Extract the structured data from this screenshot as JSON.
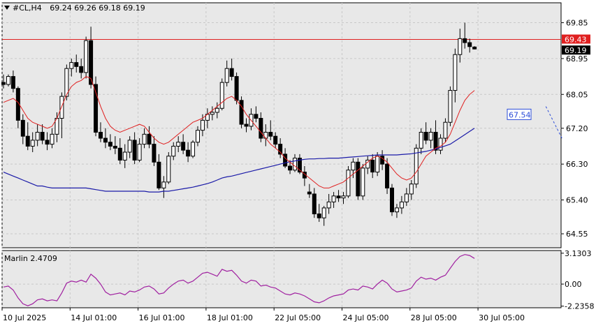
{
  "header": {
    "symbol": "#CL,H4",
    "ohlc": "69.24 69.26 69.18 69.19"
  },
  "price_tags": {
    "resistance": "69.43",
    "current": "69.19",
    "target": "67.54"
  },
  "indicator": {
    "label": "Marlin 2.4709"
  },
  "colors": {
    "background": "#ffffff",
    "plot_bg": "#e8e8e8",
    "grid": "#c8c8c8",
    "candle": "#000000",
    "red_line": "#e02020",
    "blue_ma": "#1a1aa8",
    "target_line": "#2a4bd7",
    "marlin": "#a020a0"
  },
  "chart_data": [
    {
      "type": "candlestick",
      "title": "#CL,H4",
      "ylim": [
        64.2,
        70.35
      ],
      "y_ticks": [
        "69.85",
        "68.95",
        "68.05",
        "67.20",
        "66.30",
        "65.40",
        "64.55"
      ],
      "x_ticks": [
        "10 Jul 2025",
        "14 Jul 01:00",
        "16 Jul 01:00",
        "18 Jul 01:00",
        "22 Jul 05:00",
        "24 Jul 05:00",
        "28 Jul 05:00",
        "30 Jul 05:00"
      ],
      "horizontal_line": 69.43,
      "target_line": {
        "from_index": 115,
        "from": 66.95,
        "to": 67.54
      },
      "candles": [
        [
          68.35,
          68.55,
          68.2,
          68.3
        ],
        [
          68.3,
          68.55,
          68.25,
          68.5
        ],
        [
          68.5,
          68.65,
          68.1,
          68.2
        ],
        [
          68.2,
          68.25,
          67.2,
          67.4
        ],
        [
          67.4,
          67.55,
          66.8,
          67.0
        ],
        [
          67.0,
          67.35,
          66.65,
          66.75
        ],
        [
          66.75,
          67.1,
          66.6,
          66.9
        ],
        [
          66.9,
          67.3,
          66.75,
          67.1
        ],
        [
          67.1,
          67.3,
          66.8,
          66.9
        ],
        [
          66.9,
          67.1,
          66.65,
          66.8
        ],
        [
          66.8,
          67.2,
          66.7,
          67.05
        ],
        [
          67.05,
          67.6,
          66.85,
          67.45
        ],
        [
          67.45,
          68.1,
          66.95,
          68.0
        ],
        [
          68.0,
          68.8,
          67.9,
          68.7
        ],
        [
          68.7,
          68.95,
          68.5,
          68.85
        ],
        [
          68.85,
          69.05,
          68.6,
          68.75
        ],
        [
          68.75,
          68.95,
          68.45,
          68.6
        ],
        [
          68.6,
          69.5,
          68.45,
          69.4
        ],
        [
          69.4,
          69.75,
          68.2,
          68.3
        ],
        [
          68.3,
          68.5,
          67.0,
          67.1
        ],
        [
          67.1,
          67.35,
          66.85,
          66.95
        ],
        [
          66.95,
          67.2,
          66.7,
          66.85
        ],
        [
          66.85,
          67.05,
          66.65,
          66.75
        ],
        [
          66.75,
          67.0,
          66.55,
          66.7
        ],
        [
          66.7,
          66.95,
          66.3,
          66.4
        ],
        [
          66.4,
          66.8,
          66.2,
          66.6
        ],
        [
          66.6,
          67.0,
          66.45,
          66.9
        ],
        [
          66.9,
          67.1,
          66.3,
          66.4
        ],
        [
          66.4,
          66.95,
          66.35,
          66.8
        ],
        [
          66.8,
          67.2,
          66.7,
          67.05
        ],
        [
          67.05,
          67.25,
          66.7,
          66.8
        ],
        [
          66.8,
          67.0,
          66.25,
          66.35
        ],
        [
          66.35,
          66.55,
          65.65,
          65.7
        ],
        [
          65.7,
          66.0,
          65.45,
          65.85
        ],
        [
          65.85,
          66.6,
          65.8,
          66.5
        ],
        [
          66.5,
          66.85,
          66.4,
          66.75
        ],
        [
          66.75,
          67.0,
          66.6,
          66.85
        ],
        [
          66.85,
          67.05,
          66.55,
          66.65
        ],
        [
          66.65,
          66.85,
          66.35,
          66.5
        ],
        [
          66.5,
          66.9,
          66.45,
          66.85
        ],
        [
          66.85,
          67.25,
          66.75,
          67.15
        ],
        [
          67.15,
          67.55,
          67.0,
          67.4
        ],
        [
          67.4,
          67.7,
          67.2,
          67.55
        ],
        [
          67.55,
          67.75,
          67.4,
          67.6
        ],
        [
          67.6,
          67.85,
          67.45,
          67.7
        ],
        [
          67.7,
          68.45,
          67.65,
          68.35
        ],
        [
          68.35,
          68.9,
          68.25,
          68.7
        ],
        [
          68.7,
          68.95,
          68.4,
          68.5
        ],
        [
          68.5,
          68.6,
          67.8,
          67.9
        ],
        [
          67.9,
          68.0,
          67.2,
          67.3
        ],
        [
          67.3,
          67.45,
          67.1,
          67.25
        ],
        [
          67.25,
          67.7,
          67.15,
          67.55
        ],
        [
          67.55,
          67.75,
          67.35,
          67.45
        ],
        [
          67.45,
          67.6,
          66.85,
          66.95
        ],
        [
          66.95,
          67.3,
          66.75,
          67.1
        ],
        [
          67.1,
          67.4,
          66.9,
          67.0
        ],
        [
          67.0,
          67.1,
          66.7,
          66.8
        ],
        [
          66.8,
          66.95,
          66.45,
          66.55
        ],
        [
          66.55,
          66.7,
          66.2,
          66.25
        ],
        [
          66.25,
          66.4,
          66.05,
          66.15
        ],
        [
          66.15,
          66.55,
          66.1,
          66.45
        ],
        [
          66.45,
          66.55,
          66.05,
          66.1
        ],
        [
          66.1,
          66.25,
          65.75,
          65.95
        ],
        [
          65.6,
          65.8,
          65.45,
          65.55
        ],
        [
          65.55,
          65.7,
          64.95,
          65.05
        ],
        [
          65.05,
          65.3,
          64.85,
          64.95
        ],
        [
          64.95,
          65.25,
          64.75,
          65.2
        ],
        [
          65.2,
          65.55,
          65.05,
          65.35
        ],
        [
          65.35,
          65.6,
          65.2,
          65.5
        ],
        [
          65.5,
          65.65,
          65.35,
          65.45
        ],
        [
          65.45,
          65.6,
          65.3,
          65.5
        ],
        [
          65.5,
          66.25,
          65.45,
          66.15
        ],
        [
          66.15,
          66.45,
          65.95,
          66.35
        ],
        [
          66.35,
          66.45,
          65.4,
          65.5
        ],
        [
          65.5,
          66.3,
          65.4,
          66.2
        ],
        [
          66.2,
          66.5,
          66.05,
          66.4
        ],
        [
          66.4,
          66.55,
          65.95,
          66.1
        ],
        [
          66.1,
          66.6,
          66.0,
          66.5
        ],
        [
          66.5,
          66.65,
          66.15,
          66.3
        ],
        [
          66.3,
          66.45,
          65.55,
          65.7
        ],
        [
          65.7,
          65.8,
          65.0,
          65.1
        ],
        [
          65.1,
          65.3,
          64.95,
          65.2
        ],
        [
          65.2,
          65.5,
          65.05,
          65.35
        ],
        [
          65.35,
          65.7,
          65.25,
          65.55
        ],
        [
          65.55,
          65.9,
          65.4,
          65.8
        ],
        [
          65.8,
          66.8,
          65.7,
          66.7
        ],
        [
          66.7,
          67.2,
          66.55,
          67.1
        ],
        [
          67.1,
          67.35,
          66.8,
          66.9
        ],
        [
          66.9,
          67.2,
          66.7,
          67.1
        ],
        [
          67.1,
          67.4,
          66.55,
          66.65
        ],
        [
          66.65,
          67.05,
          66.55,
          66.95
        ],
        [
          66.95,
          67.45,
          66.85,
          67.35
        ],
        [
          67.35,
          68.25,
          67.25,
          68.15
        ],
        [
          68.15,
          69.2,
          67.85,
          69.05
        ],
        [
          69.05,
          69.7,
          68.85,
          69.45
        ],
        [
          69.45,
          69.85,
          69.2,
          69.35
        ],
        [
          69.35,
          69.45,
          69.1,
          69.25
        ],
        [
          69.24,
          69.26,
          69.18,
          69.19
        ]
      ],
      "red_line": [
        67.85,
        67.9,
        67.95,
        67.85,
        67.65,
        67.45,
        67.35,
        67.3,
        67.25,
        67.2,
        67.25,
        67.45,
        67.75,
        68.05,
        68.25,
        68.35,
        68.4,
        68.5,
        68.45,
        68.1,
        67.75,
        67.45,
        67.25,
        67.15,
        67.1,
        67.15,
        67.2,
        67.25,
        67.3,
        67.25,
        67.1,
        66.95,
        66.85,
        66.8,
        66.85,
        66.95,
        67.05,
        67.15,
        67.25,
        67.35,
        67.4,
        67.45,
        67.55,
        67.65,
        67.75,
        67.85,
        67.95,
        68.0,
        67.9,
        67.75,
        67.55,
        67.4,
        67.25,
        67.1,
        66.95,
        66.8,
        66.7,
        66.6,
        66.45,
        66.35,
        66.25,
        66.15,
        66.05,
        65.95,
        65.85,
        65.75,
        65.7,
        65.7,
        65.75,
        65.8,
        65.85,
        65.95,
        66.05,
        66.15,
        66.25,
        66.35,
        66.45,
        66.5,
        66.45,
        66.35,
        66.2,
        66.05,
        65.95,
        65.9,
        65.95,
        66.1,
        66.3,
        66.5,
        66.6,
        66.7,
        66.75,
        66.85,
        67.05,
        67.35,
        67.65,
        67.9,
        68.05,
        68.15
      ],
      "blue_ma": [
        66.1,
        66.05,
        66.0,
        65.95,
        65.9,
        65.85,
        65.8,
        65.75,
        65.75,
        65.72,
        65.7,
        65.7,
        65.7,
        65.7,
        65.7,
        65.7,
        65.7,
        65.7,
        65.68,
        65.66,
        65.64,
        65.62,
        65.62,
        65.62,
        65.62,
        65.62,
        65.62,
        65.62,
        65.62,
        65.62,
        65.6,
        65.6,
        65.6,
        65.62,
        65.62,
        65.64,
        65.66,
        65.68,
        65.7,
        65.72,
        65.75,
        65.78,
        65.81,
        65.85,
        65.9,
        65.95,
        65.98,
        66.0,
        66.03,
        66.06,
        66.09,
        66.12,
        66.15,
        66.18,
        66.21,
        66.24,
        66.27,
        66.3,
        66.33,
        66.36,
        66.38,
        66.4,
        66.42,
        66.43,
        66.43,
        66.44,
        66.44,
        66.45,
        66.45,
        66.45,
        66.46,
        66.47,
        66.48,
        66.49,
        66.5,
        66.51,
        66.52,
        66.53,
        66.53,
        66.53,
        66.53,
        66.53,
        66.54,
        66.55,
        66.56,
        66.58,
        66.6,
        66.62,
        66.65,
        66.68,
        66.72,
        66.76,
        66.8,
        66.88,
        66.96,
        67.04,
        67.12,
        67.2
      ]
    },
    {
      "type": "line",
      "title": "Marlin 2.4709",
      "ylim": [
        -2.4,
        3.4
      ],
      "y_ticks": [
        "3.1303",
        "0.00",
        "-2.2358"
      ],
      "values": [
        -0.3,
        -0.2,
        -0.6,
        -1.4,
        -2.0,
        -2.2,
        -2.0,
        -1.6,
        -1.5,
        -1.7,
        -1.6,
        -1.7,
        -0.9,
        0.1,
        0.3,
        0.2,
        0.4,
        0.2,
        1.0,
        0.6,
        0.0,
        -0.8,
        -1.1,
        -1.0,
        -0.9,
        -1.1,
        -0.7,
        -0.8,
        -0.6,
        -0.3,
        -0.2,
        -0.5,
        -1.0,
        -0.9,
        -0.4,
        0.0,
        0.3,
        0.4,
        0.1,
        0.3,
        0.7,
        1.1,
        1.2,
        1.0,
        0.8,
        1.5,
        1.3,
        1.4,
        0.9,
        0.3,
        0.1,
        0.4,
        0.3,
        -0.2,
        -0.1,
        -0.3,
        -0.4,
        -0.7,
        -1.0,
        -1.1,
        -0.9,
        -1.0,
        -1.2,
        -1.5,
        -1.8,
        -1.9,
        -1.7,
        -1.4,
        -1.2,
        -1.1,
        -1.0,
        -0.6,
        -0.5,
        -0.6,
        -0.2,
        -0.3,
        -0.5,
        0.0,
        0.4,
        0.1,
        -0.5,
        -0.8,
        -0.7,
        -0.6,
        -0.4,
        0.3,
        0.7,
        0.5,
        0.6,
        0.4,
        0.7,
        0.9,
        1.6,
        2.3,
        2.8,
        3.0,
        2.9,
        2.6
      ]
    }
  ]
}
